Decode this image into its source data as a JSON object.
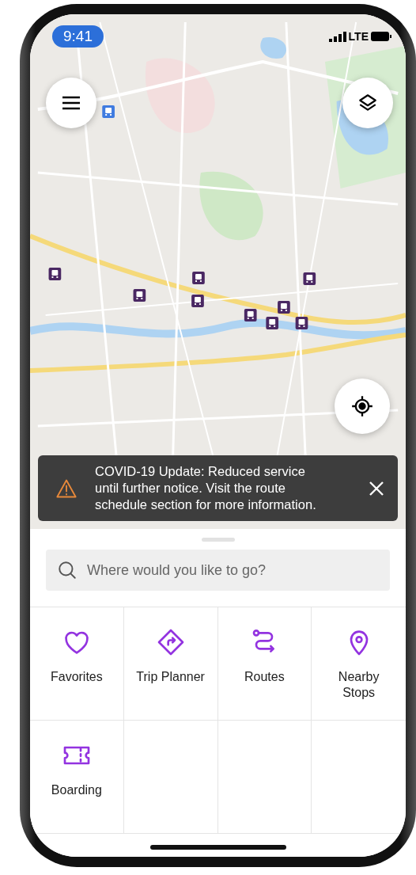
{
  "status_bar": {
    "time": "9:41",
    "network": "LTE"
  },
  "alert": {
    "message": "COVID-19 Update: Reduced service until further notice. Visit the route schedule section for more information."
  },
  "search": {
    "placeholder": "Where would you like to go?"
  },
  "tiles": [
    {
      "label": "Favorites",
      "kind": "heart"
    },
    {
      "label": "Trip Planner",
      "kind": "diamond"
    },
    {
      "label": "Routes",
      "kind": "route"
    },
    {
      "label": "Nearby Stops",
      "kind": "pin"
    },
    {
      "label": "Boarding",
      "kind": "ticket"
    }
  ]
}
